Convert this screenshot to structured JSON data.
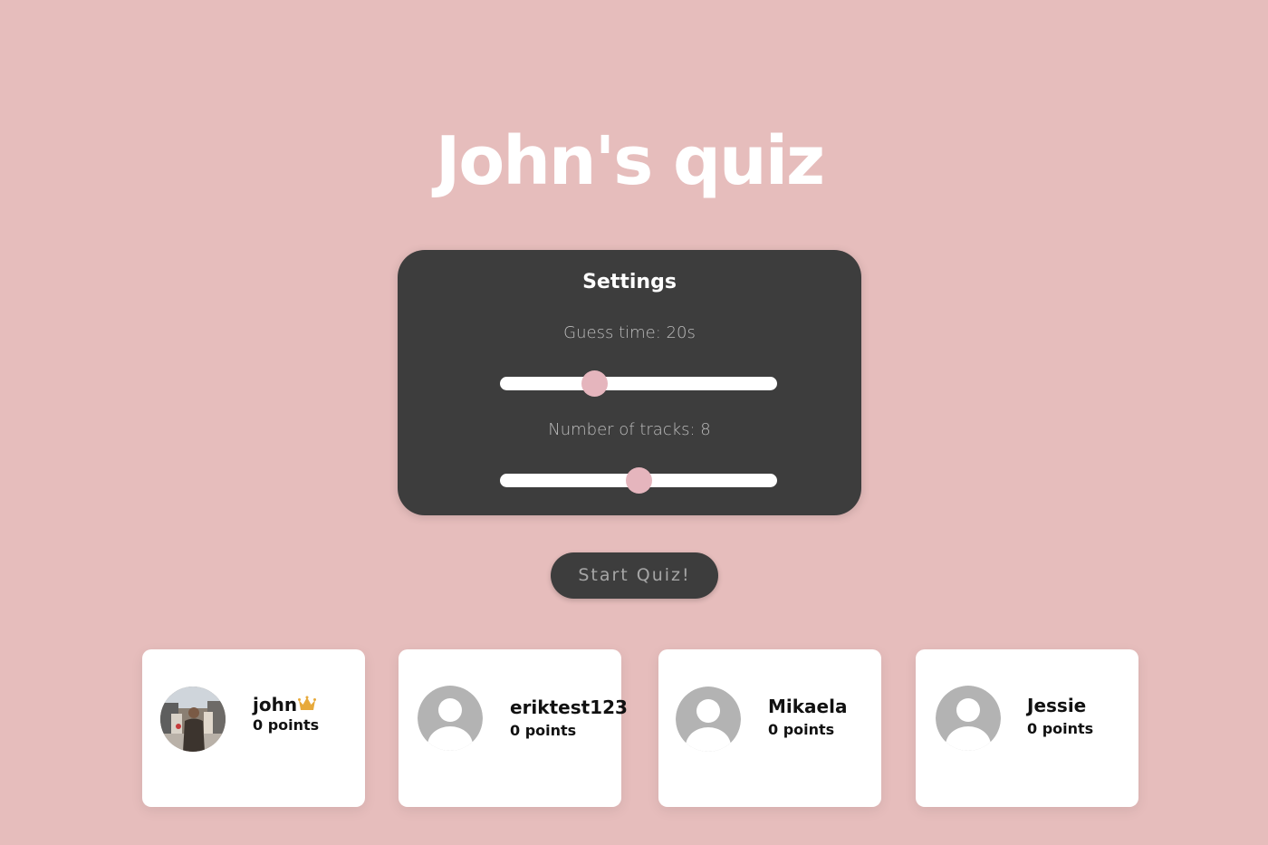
{
  "page": {
    "title": "John's quiz"
  },
  "settings": {
    "title": "Settings",
    "guess_time": {
      "label": "Guess time: 20s",
      "value": 20,
      "position_fraction": 0.34
    },
    "tracks": {
      "label": "Number of tracks: 8",
      "value": 8,
      "position_fraction": 0.5
    }
  },
  "actions": {
    "start_label": "Start Quiz!"
  },
  "players": [
    {
      "name": "john",
      "points": "0 points",
      "host": true,
      "avatar": "photo-avatar"
    },
    {
      "name": "eriktest123",
      "points": "0 points",
      "host": false,
      "avatar": "default-user-icon"
    },
    {
      "name": "Mikaela",
      "points": "0 points",
      "host": false,
      "avatar": "default-user-icon"
    },
    {
      "name": "Jessie",
      "points": "0 points",
      "host": false,
      "avatar": "default-user-icon"
    }
  ],
  "colors": {
    "background": "#e6bdbc",
    "panel": "#3d3d3d",
    "accent": "#e5b5bd",
    "crown": "#e7a93b"
  }
}
